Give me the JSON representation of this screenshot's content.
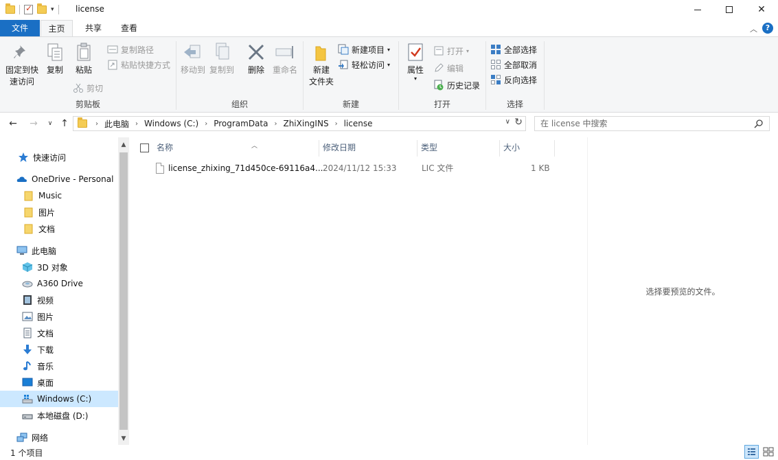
{
  "window": {
    "title": "license",
    "controls": {
      "minimize": "minimize-icon",
      "maximize": "maximize-icon",
      "close": "✕"
    }
  },
  "ribbon_tabs": {
    "file": "文件",
    "home": "主页",
    "share": "共享",
    "view": "查看"
  },
  "ribbon": {
    "clipboard": {
      "label": "剪贴板",
      "pin": "固定到快\n速访问",
      "pin_line1": "固定到快",
      "pin_line2": "速访问",
      "copy": "复制",
      "paste": "粘贴",
      "copy_path": "复制路径",
      "paste_shortcut": "粘贴快捷方式",
      "cut": "剪切"
    },
    "organize": {
      "label": "组织",
      "move_to": "移动到",
      "copy_to": "复制到",
      "delete": "删除",
      "rename": "重命名"
    },
    "new": {
      "label": "新建",
      "new_folder_line1": "新建",
      "new_folder_line2": "文件夹",
      "new_item": "新建项目",
      "easy_access": "轻松访问"
    },
    "open": {
      "label": "打开",
      "properties": "属性",
      "open": "打开",
      "edit": "编辑",
      "history": "历史记录"
    },
    "select": {
      "label": "选择",
      "select_all": "全部选择",
      "select_none": "全部取消",
      "invert": "反向选择"
    }
  },
  "address": {
    "crumbs": [
      "此电脑",
      "Windows (C:)",
      "ProgramData",
      "ZhiXingINS",
      "license"
    ],
    "search_placeholder": "在 license 中搜索"
  },
  "sidebar": {
    "items": [
      {
        "label": "快速访问",
        "icon": "star-icon"
      },
      {
        "label": "OneDrive - Personal",
        "icon": "cloud-icon"
      },
      {
        "label": "Music",
        "icon": "folder-icon"
      },
      {
        "label": "图片",
        "icon": "folder-icon"
      },
      {
        "label": "文档",
        "icon": "folder-icon"
      },
      {
        "label": "此电脑",
        "icon": "computer-icon"
      },
      {
        "label": "3D 对象",
        "icon": "cube-icon"
      },
      {
        "label": "A360 Drive",
        "icon": "drive-icon"
      },
      {
        "label": "视频",
        "icon": "video-icon"
      },
      {
        "label": "图片",
        "icon": "pictures-icon"
      },
      {
        "label": "文档",
        "icon": "documents-icon"
      },
      {
        "label": "下载",
        "icon": "download-icon"
      },
      {
        "label": "音乐",
        "icon": "music-icon"
      },
      {
        "label": "桌面",
        "icon": "desktop-icon"
      },
      {
        "label": "Windows (C:)",
        "icon": "windows-drive-icon"
      },
      {
        "label": "本地磁盘 (D:)",
        "icon": "disk-icon"
      },
      {
        "label": "网络",
        "icon": "network-icon"
      }
    ]
  },
  "file_list": {
    "columns": {
      "name": "名称",
      "date": "修改日期",
      "type": "类型",
      "size": "大小"
    },
    "rows": [
      {
        "name": "license_zhixing_71d450ce-69116a4...",
        "date": "2024/11/12 15:33",
        "type": "LIC 文件",
        "size": "1 KB"
      }
    ]
  },
  "preview": {
    "message": "选择要预览的文件。"
  },
  "status": {
    "count": "1 个项目"
  },
  "colors": {
    "accent": "#1a6fc4",
    "selected_bg": "#cce8ff",
    "ribbon_bg": "#f5f6f7"
  }
}
